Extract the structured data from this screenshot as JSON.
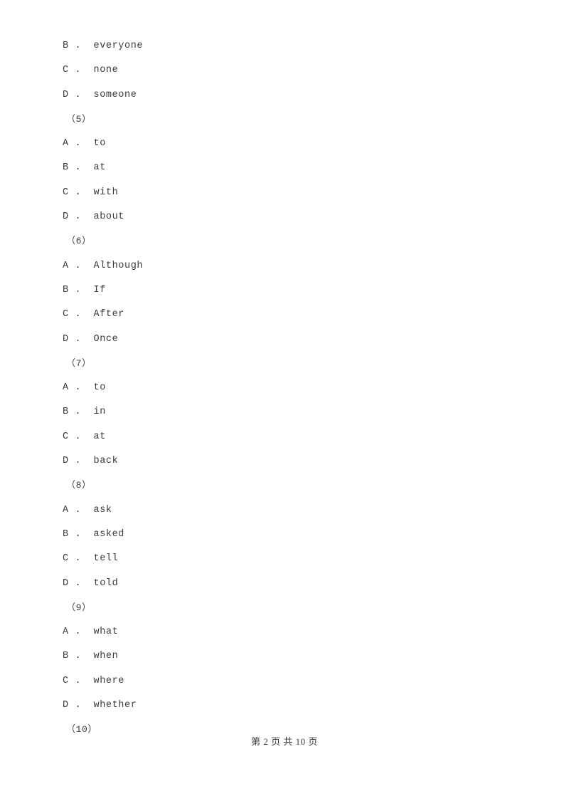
{
  "document": {
    "page_background": "#ffffff",
    "text_color": "#3b3b3b",
    "lines": [
      {
        "type": "option",
        "text": "B .  everyone"
      },
      {
        "type": "option",
        "text": "C .  none"
      },
      {
        "type": "option",
        "text": "D .  someone"
      },
      {
        "type": "qnum",
        "text": "（5）"
      },
      {
        "type": "option",
        "text": "A .  to"
      },
      {
        "type": "option",
        "text": "B .  at"
      },
      {
        "type": "option",
        "text": "C .  with"
      },
      {
        "type": "option",
        "text": "D .  about"
      },
      {
        "type": "qnum",
        "text": "（6）"
      },
      {
        "type": "option",
        "text": "A .  Although"
      },
      {
        "type": "option",
        "text": "B .  If"
      },
      {
        "type": "option",
        "text": "C .  After"
      },
      {
        "type": "option",
        "text": "D .  Once"
      },
      {
        "type": "qnum",
        "text": "（7）"
      },
      {
        "type": "option",
        "text": "A .  to"
      },
      {
        "type": "option",
        "text": "B .  in"
      },
      {
        "type": "option",
        "text": "C .  at"
      },
      {
        "type": "option",
        "text": "D .  back"
      },
      {
        "type": "qnum",
        "text": "（8）"
      },
      {
        "type": "option",
        "text": "A .  ask"
      },
      {
        "type": "option",
        "text": "B .  asked"
      },
      {
        "type": "option",
        "text": "C .  tell"
      },
      {
        "type": "option",
        "text": "D .  told"
      },
      {
        "type": "qnum",
        "text": "（9）"
      },
      {
        "type": "option",
        "text": "A .  what"
      },
      {
        "type": "option",
        "text": "B .  when"
      },
      {
        "type": "option",
        "text": "C .  where"
      },
      {
        "type": "option",
        "text": "D .  whether"
      },
      {
        "type": "qnum",
        "text": "（10）"
      }
    ]
  },
  "footer": {
    "page_label": "第 2 页 共 10 页",
    "current_page": "2",
    "total_pages": "10"
  }
}
